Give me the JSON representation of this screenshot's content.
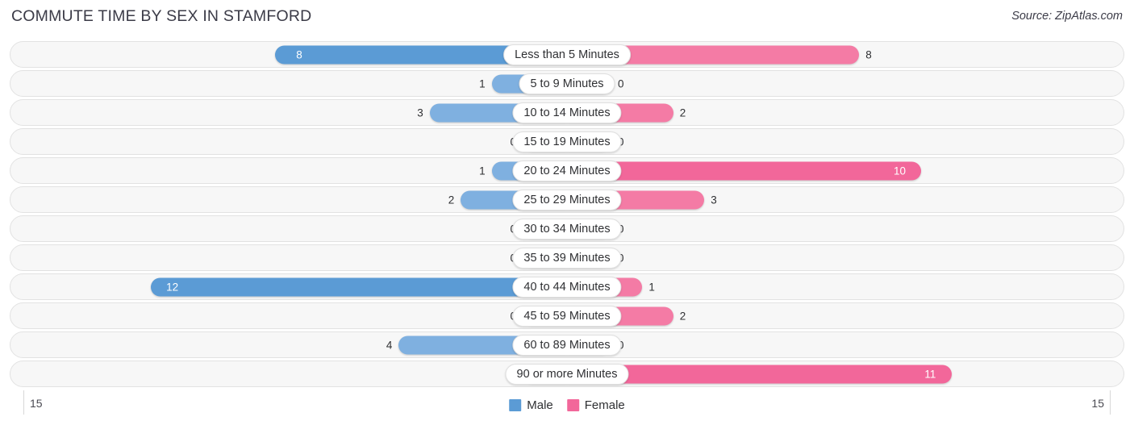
{
  "header": {
    "title": "COMMUTE TIME BY SEX IN STAMFORD",
    "source": "Source: ZipAtlas.com"
  },
  "legend": {
    "items": [
      {
        "label": "Male",
        "color": "#5b9bd5"
      },
      {
        "label": "Female",
        "color": "#f2679a"
      }
    ]
  },
  "axis": {
    "left_label": "15",
    "right_label": "15"
  },
  "colors": {
    "male_strong": "#5b9bd5",
    "male_medium": "#7fb0e0",
    "male_light": "#aecbeb",
    "female_strong": "#f2679a",
    "female_medium": "#f47ba5",
    "female_light": "#f9b3cb",
    "row_background": "#f7f7f7",
    "row_border": "#e2e2e2",
    "text": "#2f3033"
  },
  "chart_data": {
    "type": "bar",
    "title": "COMMUTE TIME BY SEX IN STAMFORD",
    "subtitle": "",
    "xlabel": "",
    "ylabel": "",
    "orientation": "horizontal-diverging",
    "axis_max": 15,
    "xlim": [
      -15,
      15
    ],
    "grid": false,
    "legend_position": "bottom-center",
    "categories": [
      "Less than 5 Minutes",
      "5 to 9 Minutes",
      "10 to 14 Minutes",
      "15 to 19 Minutes",
      "20 to 24 Minutes",
      "25 to 29 Minutes",
      "30 to 34 Minutes",
      "35 to 39 Minutes",
      "40 to 44 Minutes",
      "45 to 59 Minutes",
      "60 to 89 Minutes",
      "90 or more Minutes"
    ],
    "series": [
      {
        "name": "Male",
        "side": "left",
        "values": [
          8,
          1,
          3,
          0,
          1,
          2,
          0,
          0,
          12,
          0,
          4,
          0
        ]
      },
      {
        "name": "Female",
        "side": "right",
        "values": [
          8,
          0,
          2,
          0,
          10,
          3,
          0,
          0,
          1,
          2,
          0,
          11
        ]
      }
    ]
  }
}
